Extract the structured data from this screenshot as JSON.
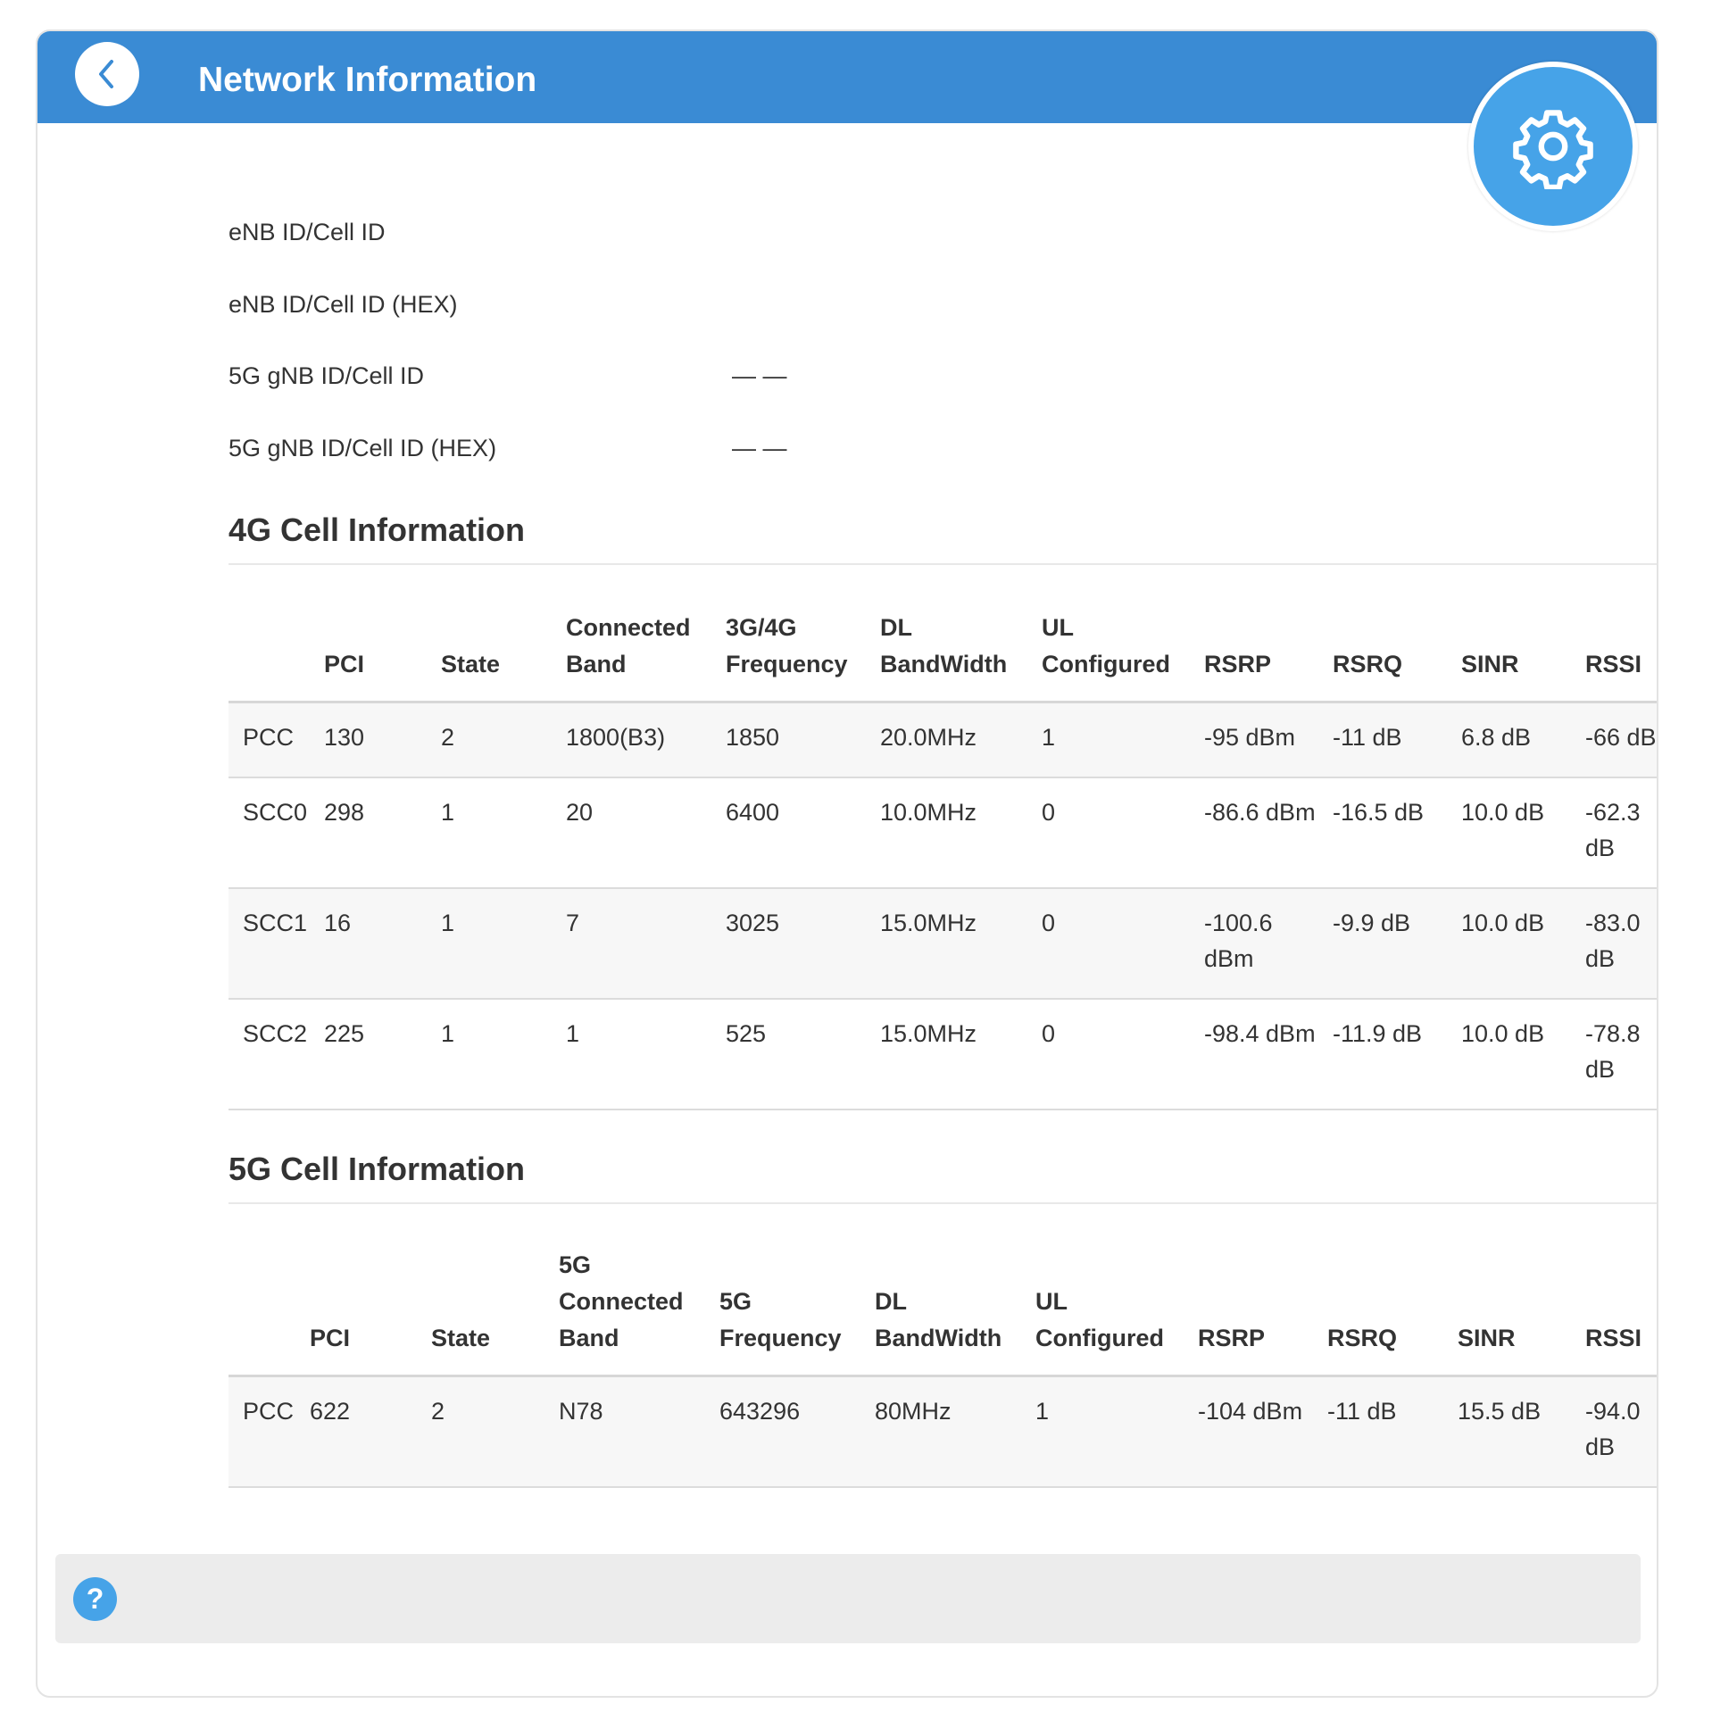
{
  "header": {
    "title": "Network Information",
    "back_icon": "chevron-left-icon",
    "settings_icon": "gear-icon"
  },
  "info": [
    {
      "label": "eNB ID/Cell ID",
      "value": ""
    },
    {
      "label": "eNB ID/Cell ID (HEX)",
      "value": ""
    },
    {
      "label": "5G gNB ID/Cell ID",
      "value": "— —"
    },
    {
      "label": "5G gNB ID/Cell ID (HEX)",
      "value": "— —"
    }
  ],
  "cell4g": {
    "title": "4G Cell Information",
    "columns": [
      "",
      "PCI",
      "State",
      "Connected Band",
      "3G/4G Frequency",
      "DL BandWidth",
      "UL Configured",
      "RSRP",
      "RSRQ",
      "SINR",
      "RSSI"
    ],
    "rows": [
      [
        "PCC",
        "130",
        "2",
        "1800(B3)",
        "1850",
        "20.0MHz",
        "1",
        "-95 dBm",
        "-11 dB",
        "6.8 dB",
        "-66 dB"
      ],
      [
        "SCC0",
        "298",
        "1",
        "20",
        "6400",
        "10.0MHz",
        "0",
        "-86.6 dBm",
        "-16.5 dB",
        "10.0 dB",
        "-62.3 dB"
      ],
      [
        "SCC1",
        "16",
        "1",
        "7",
        "3025",
        "15.0MHz",
        "0",
        "-100.6 dBm",
        "-9.9 dB",
        "10.0 dB",
        "-83.0 dB"
      ],
      [
        "SCC2",
        "225",
        "1",
        "1",
        "525",
        "15.0MHz",
        "0",
        "-98.4 dBm",
        "-11.9 dB",
        "10.0 dB",
        "-78.8 dB"
      ]
    ]
  },
  "cell5g": {
    "title": "5G Cell Information",
    "columns": [
      "",
      "PCI",
      "State",
      "5G Connected Band",
      "5G Frequency",
      "DL BandWidth",
      "UL Configured",
      "RSRP",
      "RSRQ",
      "SINR",
      "RSSI"
    ],
    "rows": [
      [
        "PCC",
        "622",
        "2",
        "N78",
        "643296",
        "80MHz",
        "1",
        "-104 dBm",
        "-11 dB",
        "15.5 dB",
        "-94.0 dB"
      ]
    ]
  },
  "help": {
    "icon": "question-icon",
    "symbol": "?"
  },
  "colors": {
    "header": "#3a8bd4",
    "accent": "#46a3e8",
    "help_bar": "#ececec",
    "row_stripe": "#f7f7f7"
  }
}
